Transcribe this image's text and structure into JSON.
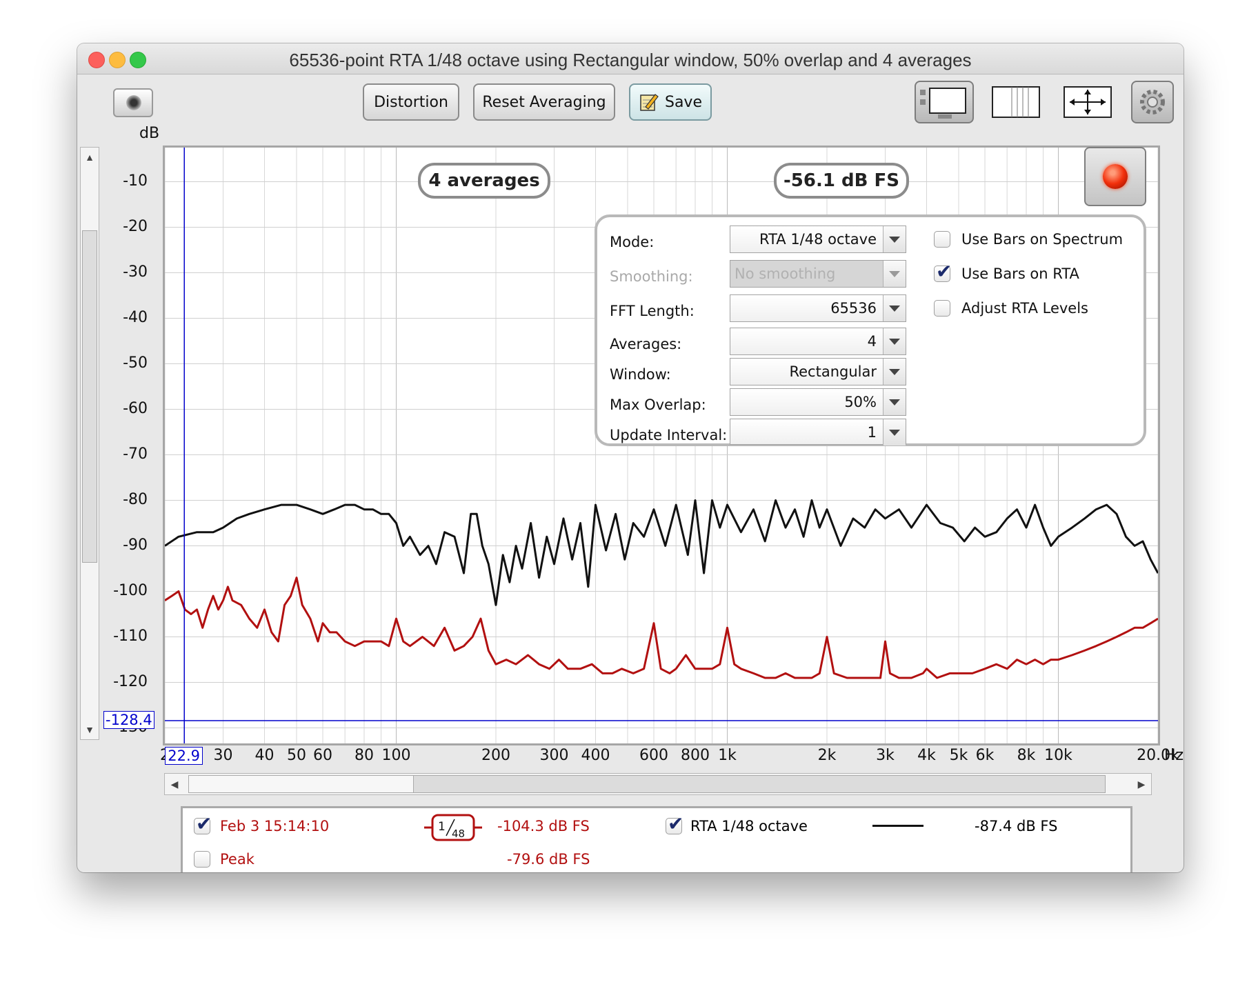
{
  "window": {
    "title": "65536-point RTA 1/48 octave using Rectangular window, 50% overlap and 4 averages"
  },
  "toolbar": {
    "camera_icon": "camera-icon",
    "distortion_label": "Distortion",
    "reset_averaging_label": "Reset Averaging",
    "save_label": "Save",
    "save_icon": "pencil-notepad-icon",
    "view_icons": [
      "graph-limits-icon",
      "columns-icon",
      "move-arrows-icon",
      "gear-icon"
    ]
  },
  "overlays": {
    "averages_badge": "4 averages",
    "level_badge": "-56.1 dB FS"
  },
  "cursor": {
    "y_value": "-128.4",
    "x_value": "22.9"
  },
  "settings": {
    "mode_label": "Mode:",
    "mode_value": "RTA 1/48 octave",
    "smoothing_label": "Smoothing:",
    "smoothing_value": "No  smoothing",
    "fft_length_label": "FFT Length:",
    "fft_length_value": "65536",
    "averages_label": "Averages:",
    "averages_value": "4",
    "window_label": "Window:",
    "window_value": "Rectangular",
    "max_overlap_label": "Max Overlap:",
    "max_overlap_value": "50%",
    "update_interval_label": "Update Interval:",
    "update_interval_value": "1",
    "use_bars_spectrum_label": "Use Bars on Spectrum",
    "use_bars_spectrum_checked": false,
    "use_bars_rta_label": "Use Bars on RTA",
    "use_bars_rta_checked": true,
    "adjust_rta_levels_label": "Adjust RTA Levels",
    "adjust_rta_levels_checked": false
  },
  "legend": {
    "row1": {
      "name": "Feb 3 15:14:10",
      "checked": true,
      "smoothing_badge_num": "1",
      "smoothing_badge_den": "48",
      "value": "-104.3 dB FS",
      "rta_name": "RTA 1/48 octave",
      "rta_checked": true,
      "rta_value": "-87.4 dB FS"
    },
    "row2": {
      "name": "Peak",
      "checked": false,
      "value": "-79.6 dB FS"
    }
  },
  "chart_data": {
    "type": "line",
    "ylabel": "dB",
    "xlabel": "Hz",
    "x_scale": "log",
    "xlim": [
      20,
      20000
    ],
    "ylim": [
      -130,
      0
    ],
    "y_ticks": [
      "-10",
      "-20",
      "-30",
      "-40",
      "-50",
      "-60",
      "-70",
      "-80",
      "-90",
      "-100",
      "-110",
      "-120",
      "-130"
    ],
    "x_ticks": [
      {
        "hz": 20,
        "label": "2"
      },
      {
        "hz": 30,
        "label": "30"
      },
      {
        "hz": 40,
        "label": "40"
      },
      {
        "hz": 50,
        "label": "50"
      },
      {
        "hz": 60,
        "label": "60"
      },
      {
        "hz": 80,
        "label": "80"
      },
      {
        "hz": 100,
        "label": "100"
      },
      {
        "hz": 200,
        "label": "200"
      },
      {
        "hz": 300,
        "label": "300"
      },
      {
        "hz": 400,
        "label": "400"
      },
      {
        "hz": 600,
        "label": "600"
      },
      {
        "hz": 800,
        "label": "800"
      },
      {
        "hz": 1000,
        "label": "1k"
      },
      {
        "hz": 2000,
        "label": "2k"
      },
      {
        "hz": 3000,
        "label": "3k"
      },
      {
        "hz": 4000,
        "label": "4k"
      },
      {
        "hz": 5000,
        "label": "5k"
      },
      {
        "hz": 6000,
        "label": "6k"
      },
      {
        "hz": 8000,
        "label": "8k"
      },
      {
        "hz": 10000,
        "label": "10k"
      },
      {
        "hz": 20000,
        "label": "20.0k"
      }
    ],
    "grid": true,
    "cursor": {
      "hz": 22.9,
      "db": -128.4,
      "color": "#0000cc"
    },
    "series": [
      {
        "name": "RTA 1/48 octave",
        "color": "#111111",
        "points": [
          [
            20,
            -90
          ],
          [
            22,
            -88
          ],
          [
            25,
            -87
          ],
          [
            28,
            -87
          ],
          [
            30,
            -86
          ],
          [
            33,
            -84
          ],
          [
            36,
            -83
          ],
          [
            40,
            -82
          ],
          [
            45,
            -81
          ],
          [
            50,
            -81
          ],
          [
            55,
            -82
          ],
          [
            60,
            -83
          ],
          [
            65,
            -82
          ],
          [
            70,
            -81
          ],
          [
            75,
            -81
          ],
          [
            80,
            -82
          ],
          [
            85,
            -82
          ],
          [
            90,
            -83
          ],
          [
            95,
            -83
          ],
          [
            100,
            -85
          ],
          [
            105,
            -90
          ],
          [
            110,
            -88
          ],
          [
            118,
            -92
          ],
          [
            125,
            -90
          ],
          [
            132,
            -94
          ],
          [
            140,
            -87
          ],
          [
            150,
            -88
          ],
          [
            160,
            -96
          ],
          [
            168,
            -83
          ],
          [
            175,
            -83
          ],
          [
            182,
            -90
          ],
          [
            190,
            -94
          ],
          [
            200,
            -103
          ],
          [
            210,
            -92
          ],
          [
            220,
            -98
          ],
          [
            230,
            -90
          ],
          [
            240,
            -95
          ],
          [
            255,
            -85
          ],
          [
            270,
            -97
          ],
          [
            285,
            -88
          ],
          [
            300,
            -94
          ],
          [
            320,
            -84
          ],
          [
            340,
            -93
          ],
          [
            360,
            -85
          ],
          [
            380,
            -99
          ],
          [
            400,
            -81
          ],
          [
            430,
            -91
          ],
          [
            460,
            -83
          ],
          [
            490,
            -93
          ],
          [
            520,
            -85
          ],
          [
            560,
            -88
          ],
          [
            600,
            -82
          ],
          [
            650,
            -90
          ],
          [
            700,
            -81
          ],
          [
            760,
            -92
          ],
          [
            800,
            -80
          ],
          [
            850,
            -96
          ],
          [
            900,
            -80
          ],
          [
            950,
            -86
          ],
          [
            1000,
            -81
          ],
          [
            1100,
            -87
          ],
          [
            1200,
            -82
          ],
          [
            1300,
            -89
          ],
          [
            1400,
            -80
          ],
          [
            1500,
            -86
          ],
          [
            1600,
            -82
          ],
          [
            1700,
            -88
          ],
          [
            1800,
            -80
          ],
          [
            1900,
            -86
          ],
          [
            2000,
            -82
          ],
          [
            2200,
            -90
          ],
          [
            2400,
            -84
          ],
          [
            2600,
            -86
          ],
          [
            2800,
            -82
          ],
          [
            3000,
            -84
          ],
          [
            3300,
            -82
          ],
          [
            3600,
            -86
          ],
          [
            4000,
            -81
          ],
          [
            4400,
            -85
          ],
          [
            4800,
            -86
          ],
          [
            5200,
            -89
          ],
          [
            5600,
            -86
          ],
          [
            6000,
            -88
          ],
          [
            6500,
            -87
          ],
          [
            7000,
            -84
          ],
          [
            7500,
            -82
          ],
          [
            8000,
            -86
          ],
          [
            8500,
            -81
          ],
          [
            9000,
            -86
          ],
          [
            9500,
            -90
          ],
          [
            10000,
            -88
          ],
          [
            11000,
            -86
          ],
          [
            12000,
            -84
          ],
          [
            13000,
            -82
          ],
          [
            14000,
            -81
          ],
          [
            15000,
            -83
          ],
          [
            16000,
            -88
          ],
          [
            17000,
            -90
          ],
          [
            18000,
            -89
          ],
          [
            19000,
            -93
          ],
          [
            20000,
            -96
          ]
        ]
      },
      {
        "name": "Feb 3 15:14:10",
        "color": "#b21010",
        "points": [
          [
            20,
            -102
          ],
          [
            21,
            -101
          ],
          [
            22,
            -100
          ],
          [
            23,
            -104
          ],
          [
            24,
            -105
          ],
          [
            25,
            -104
          ],
          [
            26,
            -108
          ],
          [
            27,
            -104
          ],
          [
            28,
            -101
          ],
          [
            29,
            -104
          ],
          [
            30,
            -102
          ],
          [
            31,
            -99
          ],
          [
            32,
            -102
          ],
          [
            34,
            -103
          ],
          [
            36,
            -106
          ],
          [
            38,
            -108
          ],
          [
            40,
            -104
          ],
          [
            42,
            -109
          ],
          [
            44,
            -111
          ],
          [
            46,
            -103
          ],
          [
            48,
            -101
          ],
          [
            50,
            -97
          ],
          [
            52,
            -103
          ],
          [
            55,
            -106
          ],
          [
            58,
            -111
          ],
          [
            60,
            -107
          ],
          [
            63,
            -109
          ],
          [
            66,
            -109
          ],
          [
            70,
            -111
          ],
          [
            75,
            -112
          ],
          [
            80,
            -111
          ],
          [
            85,
            -111
          ],
          [
            90,
            -111
          ],
          [
            95,
            -112
          ],
          [
            100,
            -106
          ],
          [
            105,
            -111
          ],
          [
            110,
            -112
          ],
          [
            120,
            -110
          ],
          [
            130,
            -112
          ],
          [
            140,
            -108
          ],
          [
            150,
            -113
          ],
          [
            160,
            -112
          ],
          [
            170,
            -110
          ],
          [
            180,
            -106
          ],
          [
            190,
            -113
          ],
          [
            200,
            -116
          ],
          [
            215,
            -115
          ],
          [
            230,
            -116
          ],
          [
            250,
            -114
          ],
          [
            270,
            -116
          ],
          [
            290,
            -117
          ],
          [
            310,
            -115
          ],
          [
            330,
            -117
          ],
          [
            360,
            -117
          ],
          [
            390,
            -116
          ],
          [
            420,
            -118
          ],
          [
            450,
            -118
          ],
          [
            480,
            -117
          ],
          [
            520,
            -118
          ],
          [
            560,
            -117
          ],
          [
            600,
            -107
          ],
          [
            630,
            -117
          ],
          [
            670,
            -118
          ],
          [
            700,
            -117
          ],
          [
            750,
            -114
          ],
          [
            800,
            -117
          ],
          [
            850,
            -117
          ],
          [
            900,
            -117
          ],
          [
            950,
            -116
          ],
          [
            1000,
            -108
          ],
          [
            1050,
            -116
          ],
          [
            1100,
            -117
          ],
          [
            1200,
            -118
          ],
          [
            1300,
            -119
          ],
          [
            1400,
            -119
          ],
          [
            1500,
            -118
          ],
          [
            1600,
            -119
          ],
          [
            1700,
            -119
          ],
          [
            1800,
            -119
          ],
          [
            1900,
            -118
          ],
          [
            2000,
            -110
          ],
          [
            2100,
            -118
          ],
          [
            2300,
            -119
          ],
          [
            2500,
            -119
          ],
          [
            2700,
            -119
          ],
          [
            2900,
            -119
          ],
          [
            3000,
            -111
          ],
          [
            3100,
            -118
          ],
          [
            3300,
            -119
          ],
          [
            3600,
            -119
          ],
          [
            3900,
            -118
          ],
          [
            4000,
            -117
          ],
          [
            4300,
            -119
          ],
          [
            4700,
            -118
          ],
          [
            5000,
            -118
          ],
          [
            5500,
            -118
          ],
          [
            6000,
            -117
          ],
          [
            6500,
            -116
          ],
          [
            7000,
            -117
          ],
          [
            7500,
            -115
          ],
          [
            8000,
            -116
          ],
          [
            8500,
            -115
          ],
          [
            9000,
            -116
          ],
          [
            9500,
            -115
          ],
          [
            10000,
            -115
          ],
          [
            11000,
            -114
          ],
          [
            12000,
            -113
          ],
          [
            13000,
            -112
          ],
          [
            14000,
            -111
          ],
          [
            15000,
            -110
          ],
          [
            16000,
            -109
          ],
          [
            17000,
            -108
          ],
          [
            18000,
            -108
          ],
          [
            19000,
            -107
          ],
          [
            20000,
            -106
          ]
        ]
      }
    ]
  }
}
